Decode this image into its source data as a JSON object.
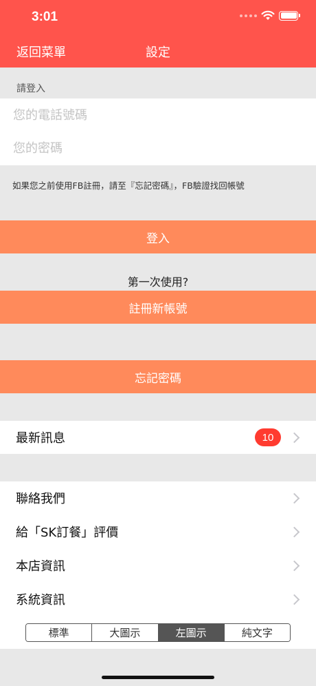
{
  "status_bar": {
    "time": "3:01"
  },
  "header": {
    "back_label": "返回菜單",
    "title": "設定"
  },
  "login": {
    "section_label": "請登入",
    "phone_placeholder": "您的電話號碼",
    "password_placeholder": "您的密碼",
    "hint": "如果您之前使用FB註冊，請至『忘記密碼』，FB驗證找回帳號",
    "login_button": "登入",
    "first_time": "第一次使用?",
    "register_button": "註冊新帳號",
    "forgot_button": "忘記密碼"
  },
  "news": {
    "label": "最新訊息",
    "badge": "10"
  },
  "menu": {
    "items": [
      {
        "label": "聯絡我們"
      },
      {
        "label": "給「SK訂餐」評價"
      },
      {
        "label": "本店資訊"
      },
      {
        "label": "系統資訊"
      }
    ]
  },
  "display_mode": {
    "options": [
      "標準",
      "大圖示",
      "左圖示",
      "純文字"
    ],
    "selected": "左圖示"
  },
  "colors": {
    "header": "#ff544c",
    "button": "#ff8a5b",
    "badge": "#ff3b30"
  }
}
